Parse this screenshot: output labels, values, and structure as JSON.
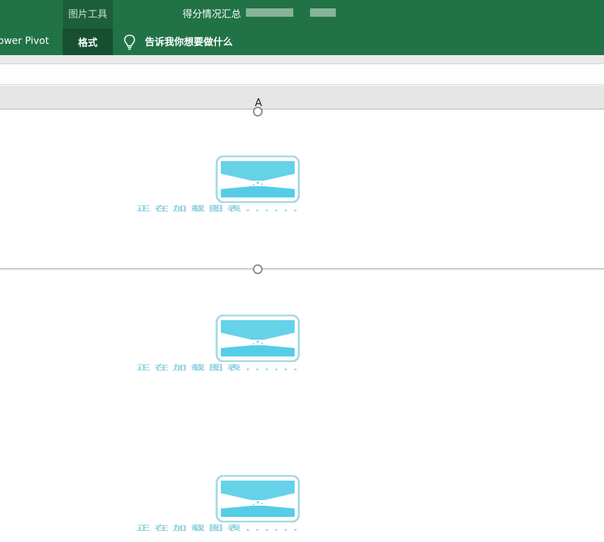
{
  "ribbon": {
    "context_group": "图片工具",
    "context_tab": "格式",
    "doc_title": "得分情况汇总",
    "tab_left": "ower Pivot",
    "tell_me": "告诉我你想要做什么",
    "colors": {
      "ribbon_bg": "#217346",
      "context_tab_bg": "#174f31"
    }
  },
  "sheet": {
    "column_a": "A",
    "loading_text": "正在加载图表......"
  },
  "icons": {
    "tell_me": "lightbulb-icon",
    "placeholder": "hourglass-icon"
  }
}
